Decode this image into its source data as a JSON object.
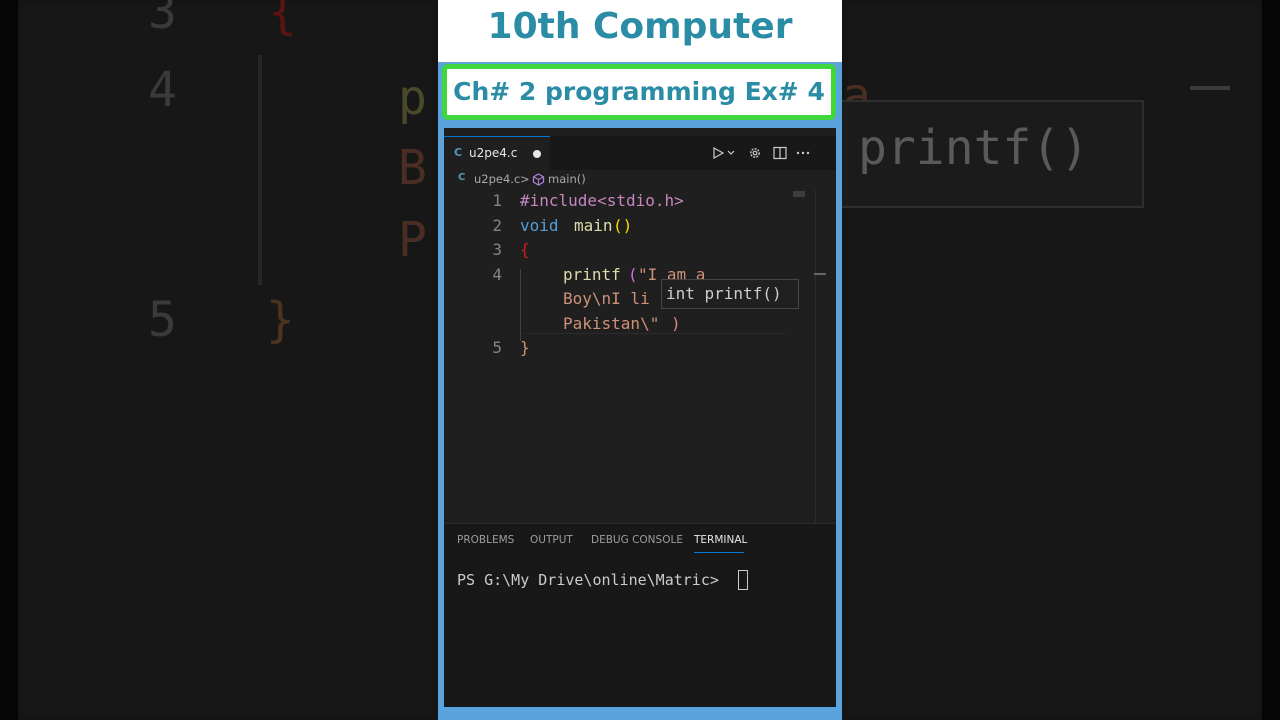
{
  "overlay": {
    "title": "10th Computer",
    "subtitle": "Ch# 2 programming Ex# 4"
  },
  "background_blur": {
    "line3": "3",
    "line4": "4",
    "line5": "5",
    "brace_open": "{",
    "brace_close": "}",
    "frag1": "p",
    "frag2": "B",
    "frag3": "P",
    "frag_a": "a",
    "hover_text": "printf()"
  },
  "editor": {
    "tab": {
      "icon_label": "C",
      "filename": "u2pe4.c",
      "modified": true
    },
    "breadcrumb": {
      "file": "u2pe4.c",
      "separator": ">",
      "symbol": "main()"
    },
    "line_numbers": [
      "1",
      "2",
      "3",
      "4",
      "5"
    ],
    "code": {
      "l1": "#include<stdio.h>",
      "l2_kw": "void",
      "l2_fn": "main",
      "l2_paren": "()",
      "l3": "{",
      "l4a_fn": "printf",
      "l4a_paren": "(",
      "l4a_str": "\"I am a",
      "l4b_str": "Boy\\nI li",
      "l4c_str": "Pakistan\\\"",
      "l4c_paren": ")",
      "l5": "}"
    },
    "hover_signature": "int printf()"
  },
  "panel": {
    "tabs": [
      "PROBLEMS",
      "OUTPUT",
      "DEBUG CONSOLE",
      "TERMINAL"
    ],
    "active_tab": "TERMINAL",
    "prompt": "PS G:\\My Drive\\online\\Matric> "
  },
  "icons": [
    "run-icon",
    "dropdown-chevron-icon",
    "gear-icon",
    "split-editor-icon",
    "more-icon",
    "c-file-icon",
    "symbol-method-icon"
  ],
  "colors": {
    "title_text": "#2b8ca5",
    "subtitle_border": "#3ed83e",
    "frame": "#5aa3dd",
    "editor_bg": "#1f1f1f",
    "keyword": "#569cd6",
    "function": "#dcdcaa",
    "string": "#ce9178",
    "preprocessor": "#c586c0",
    "bracket": "#ffd700"
  }
}
